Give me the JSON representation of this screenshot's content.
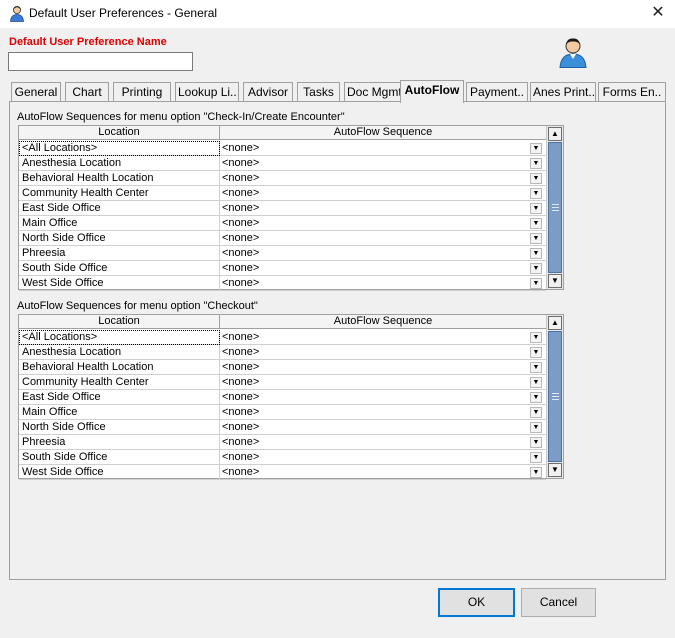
{
  "window": {
    "title": "Default User Preferences - General",
    "close_glyph": "✕"
  },
  "name_field": {
    "label": "Default User Preference Name",
    "value": ""
  },
  "tabs": [
    {
      "label": "General"
    },
    {
      "label": "Chart"
    },
    {
      "label": "Printing"
    },
    {
      "label": "Lookup Li.."
    },
    {
      "label": "Advisor"
    },
    {
      "label": "Tasks"
    },
    {
      "label": "Doc Mgmt"
    },
    {
      "label": "AutoFlow",
      "active": true
    },
    {
      "label": "Payment.."
    },
    {
      "label": "Anes Print.."
    },
    {
      "label": "Forms En.."
    }
  ],
  "sections": [
    {
      "label": "AutoFlow Sequences for menu option \"Check-In/Create Encounter\"",
      "columns": [
        "Location",
        "AutoFlow Sequence"
      ],
      "rows": [
        {
          "location": "<All Locations>",
          "sequence": "<none>"
        },
        {
          "location": "Anesthesia Location",
          "sequence": "<none>"
        },
        {
          "location": "Behavioral Health Location",
          "sequence": "<none>"
        },
        {
          "location": "Community Health Center",
          "sequence": "<none>"
        },
        {
          "location": "East Side Office",
          "sequence": "<none>"
        },
        {
          "location": "Main Office",
          "sequence": "<none>"
        },
        {
          "location": "North Side Office",
          "sequence": "<none>"
        },
        {
          "location": "Phreesia",
          "sequence": "<none>"
        },
        {
          "location": "South Side Office",
          "sequence": "<none>"
        },
        {
          "location": "West Side Office",
          "sequence": "<none>"
        }
      ]
    },
    {
      "label": "AutoFlow Sequences for menu option \"Checkout\"",
      "columns": [
        "Location",
        "AutoFlow Sequence"
      ],
      "rows": [
        {
          "location": "<All Locations>",
          "sequence": "<none>"
        },
        {
          "location": "Anesthesia Location",
          "sequence": "<none>"
        },
        {
          "location": "Behavioral Health Location",
          "sequence": "<none>"
        },
        {
          "location": "Community Health Center",
          "sequence": "<none>"
        },
        {
          "location": "East Side Office",
          "sequence": "<none>"
        },
        {
          "location": "Main Office",
          "sequence": "<none>"
        },
        {
          "location": "North Side Office",
          "sequence": "<none>"
        },
        {
          "location": "Phreesia",
          "sequence": "<none>"
        },
        {
          "location": "South Side Office",
          "sequence": "<none>"
        },
        {
          "location": "West Side Office",
          "sequence": "<none>"
        }
      ]
    }
  ],
  "buttons": {
    "ok": "OK",
    "cancel": "Cancel"
  },
  "colors": {
    "name_label": "#e00000",
    "scroll_thumb": "#7a9cc6"
  },
  "icons": {
    "title": "user-icon",
    "avatar": "user-avatar-icon",
    "dropdown": "chevron-down-icon"
  }
}
